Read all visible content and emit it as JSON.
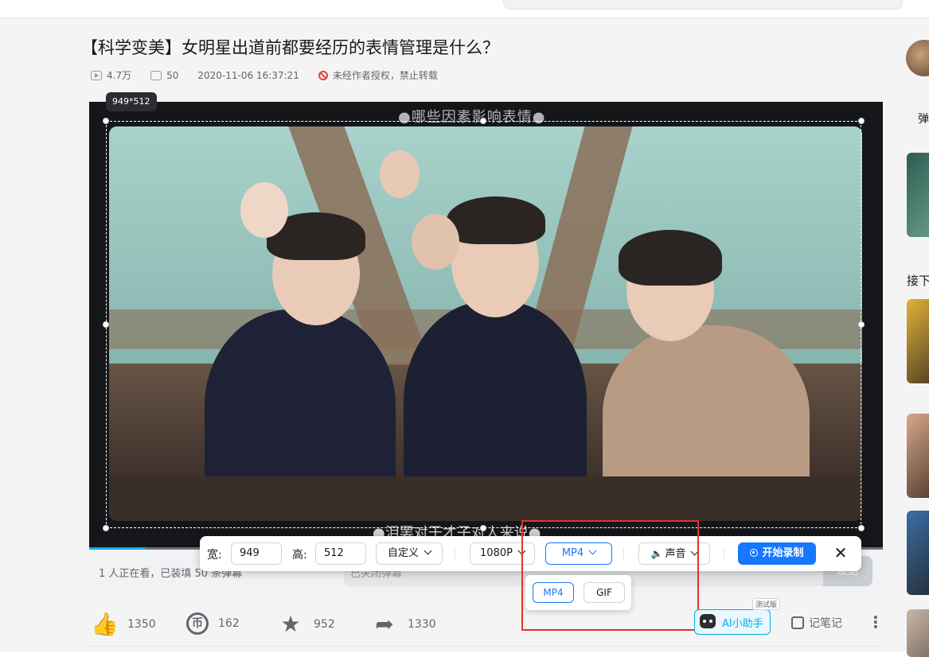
{
  "video": {
    "title": "【科学变美】女明星出道前都要经历的表情管理是什么？",
    "views": "4.7万",
    "danmaku_count": "50",
    "datetime": "2020-11-06 16:37:21",
    "copyright_notice": "未经作者授权，禁止转载",
    "caption_top": "●哪些因素影响表情●",
    "caption_bottom": "●泪罢对于才子对人来说●"
  },
  "capture": {
    "size_badge": "949*512",
    "width_label": "宽:",
    "width_value": "949",
    "height_label": "高:",
    "height_value": "512",
    "preset": "自定义",
    "resolution": "1080P",
    "format": "MP4",
    "audio": "声音",
    "start_label": "开始录制",
    "close_symbol": "✕",
    "format_options": [
      "MP4",
      "GIF"
    ],
    "accent_color": "#1677ff"
  },
  "danmaku_bar": {
    "status": "1 人正在看，已装填 50 条弹幕",
    "placeholder": "已关闭弹幕",
    "send_label": "发送"
  },
  "actions": {
    "like_count": "1350",
    "coin_count": "162",
    "coin_glyph": "币",
    "favorite_count": "952",
    "share_count": "1330",
    "ai_label": "AI小助手",
    "beta_label": "测试版",
    "notes_label": "记笔记",
    "more_symbol": "⋮"
  },
  "sidebar": {
    "danmaku_tab": "弹",
    "next_label": "接下"
  }
}
